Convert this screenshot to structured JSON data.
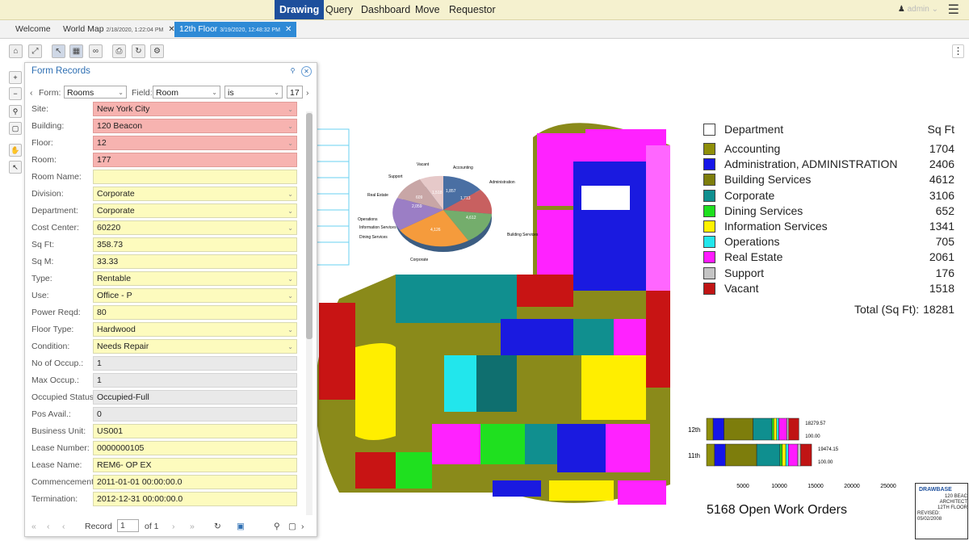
{
  "top_menu": {
    "items": [
      "Drawing",
      "Query",
      "Dashboard",
      "Move",
      "Requestor"
    ],
    "active": "Drawing",
    "user": "admin"
  },
  "tabs": [
    {
      "label": "Welcome",
      "sub": ""
    },
    {
      "label": "World Map",
      "sub": "2/18/2020, 1:22:04 PM"
    },
    {
      "label": "12th Floor",
      "sub": "3/19/2020, 12:48:32 PM"
    }
  ],
  "panel": {
    "title": "Form Records",
    "form_label": "Form:",
    "form_value": "Rooms",
    "field_label": "Field:",
    "field_value": "Room",
    "op_value": "is",
    "search_value": "17",
    "rows": [
      {
        "label": "Site:",
        "value": "New York City",
        "kind": "req",
        "dd": true
      },
      {
        "label": "Building:",
        "value": "120 Beacon",
        "kind": "req",
        "dd": true
      },
      {
        "label": "Floor:",
        "value": "12",
        "kind": "req",
        "dd": true
      },
      {
        "label": "Room:",
        "value": "177",
        "kind": "req",
        "dd": false
      },
      {
        "label": "Room Name:",
        "value": "",
        "kind": "edit",
        "dd": false
      },
      {
        "label": "Division:",
        "value": "Corporate",
        "kind": "edit",
        "dd": true
      },
      {
        "label": "Department:",
        "value": "Corporate",
        "kind": "edit",
        "dd": true
      },
      {
        "label": "Cost Center:",
        "value": "60220",
        "kind": "edit",
        "dd": true
      },
      {
        "label": "Sq Ft:",
        "value": "358.73",
        "kind": "edit",
        "dd": false
      },
      {
        "label": "Sq M:",
        "value": "33.33",
        "kind": "edit",
        "dd": false
      },
      {
        "label": "Type:",
        "value": "Rentable",
        "kind": "edit",
        "dd": true
      },
      {
        "label": "Use:",
        "value": "Office - P",
        "kind": "edit",
        "dd": true
      },
      {
        "label": "Power Reqd:",
        "value": "80",
        "kind": "edit",
        "dd": false
      },
      {
        "label": "Floor Type:",
        "value": "Hardwood",
        "kind": "edit",
        "dd": true
      },
      {
        "label": "Condition:",
        "value": "Needs Repair",
        "kind": "edit",
        "dd": true
      },
      {
        "label": "No of Occup.:",
        "value": "1",
        "kind": "ro",
        "dd": false
      },
      {
        "label": "Max Occup.:",
        "value": "1",
        "kind": "ro",
        "dd": false
      },
      {
        "label": "Occupied Status:",
        "value": "Occupied-Full",
        "kind": "ro",
        "dd": false
      },
      {
        "label": "Pos Avail.:",
        "value": "0",
        "kind": "ro",
        "dd": false
      },
      {
        "label": "Business Unit:",
        "value": "US001",
        "kind": "edit",
        "dd": false
      },
      {
        "label": "Lease Number:",
        "value": "0000000105",
        "kind": "edit",
        "dd": false
      },
      {
        "label": "Lease Name:",
        "value": "REM6- OP EX",
        "kind": "edit",
        "dd": false
      },
      {
        "label": "Commencement:",
        "value": "2011-01-01 00:00:00.0",
        "kind": "edit",
        "dd": false
      },
      {
        "label": "Termination:",
        "value": "2012-12-31 00:00:00.0",
        "kind": "edit",
        "dd": false
      }
    ],
    "pager": {
      "record_label": "Record",
      "record": "1",
      "of": "of 1"
    }
  },
  "legend": {
    "header": "Department",
    "sqft_header": "Sq Ft",
    "items": [
      {
        "name": "Accounting",
        "sqft": "1704",
        "color": "#8f8f0a"
      },
      {
        "name": "Administration, ADMINISTRATION",
        "sqft": "2406",
        "color": "#1515e8"
      },
      {
        "name": "Building Services",
        "sqft": "4612",
        "color": "#7d7d0c"
      },
      {
        "name": "Corporate",
        "sqft": "3106",
        "color": "#0f8f8f"
      },
      {
        "name": "Dining Services",
        "sqft": "652",
        "color": "#1fe01f"
      },
      {
        "name": "Information Services",
        "sqft": "1341",
        "color": "#fff200"
      },
      {
        "name": "Operations",
        "sqft": "705",
        "color": "#22e6ec"
      },
      {
        "name": "Real Estate",
        "sqft": "2061",
        "color": "#ff1aff"
      },
      {
        "name": "Support",
        "sqft": "176",
        "color": "#c4c4c4"
      },
      {
        "name": "Vacant",
        "sqft": "1518",
        "color": "#c01414"
      }
    ],
    "total_label": "Total (Sq Ft):",
    "total": "18281"
  },
  "pie_labels": [
    "Vacant",
    "Accounting",
    "Administration",
    "Support",
    "Real Estate",
    "Operations",
    "Information Services",
    "Dining Services",
    "Corporate",
    "Building Services"
  ],
  "pie_values": [
    "1,518",
    "1,857",
    "1,713",
    "609",
    "2,059",
    "4,126",
    "4,612"
  ],
  "chart_data": {
    "type": "bar",
    "categories": [
      "12th",
      "11th"
    ],
    "values": [
      18279.57,
      19474.15
    ],
    "value_labels": [
      "18279.57",
      "19474.15"
    ],
    "percent_labels": [
      "100.00",
      "100.00"
    ],
    "x_ticks": [
      "5000",
      "10000",
      "15000",
      "20000",
      "25000"
    ],
    "xlim": [
      0,
      25000
    ],
    "segments_12th": [
      900,
      1500,
      4000,
      2600,
      250,
      400,
      300,
      1100,
      250,
      1400
    ],
    "segments_11th": [
      1100,
      1500,
      4300,
      3200,
      300,
      500,
      350,
      1300,
      400,
      1500
    ]
  },
  "work_orders": "5168 Open Work Orders",
  "title_block": {
    "company": "DRAWBASE",
    "line1": "120 BEAC",
    "line2": "ARCHITECT",
    "line3": "12TH FLOOR",
    "revised": "REVISED:",
    "date": "05/02/2008"
  }
}
